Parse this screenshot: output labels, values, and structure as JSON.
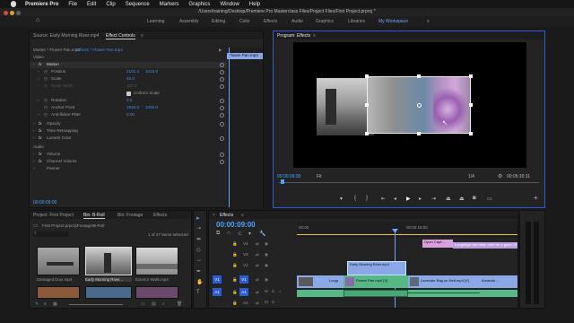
{
  "menu": {
    "app_name": "Premiere Pro",
    "items": [
      "File",
      "Edit",
      "Clip",
      "Sequence",
      "Markers",
      "Graphics",
      "Window",
      "Help"
    ]
  },
  "window_path": "/Users/training/Desktop/Premiere Pro Masterclass Files/Project Files/First Project.prproj *",
  "workspaces": [
    "Learning",
    "Assembly",
    "Editing",
    "Color",
    "Effects",
    "Audio",
    "Graphics",
    "Libraries",
    "My Workspace"
  ],
  "workspace_more": "»",
  "source_panel": {
    "source_tab": "Source: Early Morning River.mp4",
    "effect_controls_tab": "Effect Controls",
    "master_label": "Master * Flower Pan.mp4",
    "clip_label": "Effects * Flower Pan.mp4",
    "mini_timeline_clip": "Flower Pan.mp4",
    "video_header": "Video",
    "fx_label": "fx",
    "motion_label": "Motion",
    "properties": [
      {
        "label": "Position",
        "value": "2101.4",
        "value2": "1015.6"
      },
      {
        "label": "Scale",
        "value": "45.0",
        "value2": ""
      },
      {
        "label": "Scale Width",
        "value": "100.0",
        "value2": ""
      },
      {
        "label": "",
        "value": "Uniform Scale",
        "value2": ""
      },
      {
        "label": "Rotation",
        "value": "0.0",
        "value2": ""
      },
      {
        "label": "Anchor Point",
        "value": "1920.0",
        "value2": "1080.0"
      },
      {
        "label": "Anti-flicker Filter",
        "value": "0.00",
        "value2": ""
      }
    ],
    "sections": [
      "Opacity",
      "Time Remapping",
      "Lumetri Color"
    ],
    "audio_header": "Audio",
    "audio_items": [
      "Volume",
      "Channel Volume",
      "Panner"
    ],
    "timecode": "00:00:09:00"
  },
  "program_panel": {
    "tab": "Program: Effects",
    "timecode_left": "00:00:09:00",
    "fit": "Fit",
    "resolution": "1/4",
    "timecode_right": "00:05:10:11"
  },
  "project_panel": {
    "tabs": [
      "Project: First Project",
      "Bin: B-Roll",
      "Bin: Footage",
      "Effects"
    ],
    "path": "First Project.prproj\\Footage\\B-Roll",
    "items_selected": "1 of 47 items selected",
    "clips": [
      "Damaged Door.mp4",
      "Early Morning River...",
      "Exterior Walls.mp4"
    ]
  },
  "timeline_panel": {
    "tab": "Effects",
    "timecode": "00:00:09:00",
    "ruler_labels": [
      "00:00",
      "00:00:15:00"
    ],
    "track_labels": [
      "V4",
      "V3",
      "V2",
      "V1",
      "A1",
      "A2"
    ],
    "clips": {
      "open_caption": "Open Capt...",
      "caption_text": "Longridge has been here for a good 70 y",
      "early_morning": "Early Morning River.mp4",
      "flower_pan": "Flower Pan.mp4 [V]",
      "lavender": "Lavender Bag on Nett.mp4 [V]",
      "longr": "Longr",
      "amanda": "Amanda ...",
      "v1_mid": "Lo"
    }
  },
  "colors": {
    "accent_blue": "#3d8ee6",
    "timecode": "#4da3ff",
    "clip_blue": "#8aa8e6",
    "clip_green": "#56b884",
    "clip_pink": "#d8a0dc",
    "playhead": "#6fa0ff"
  }
}
